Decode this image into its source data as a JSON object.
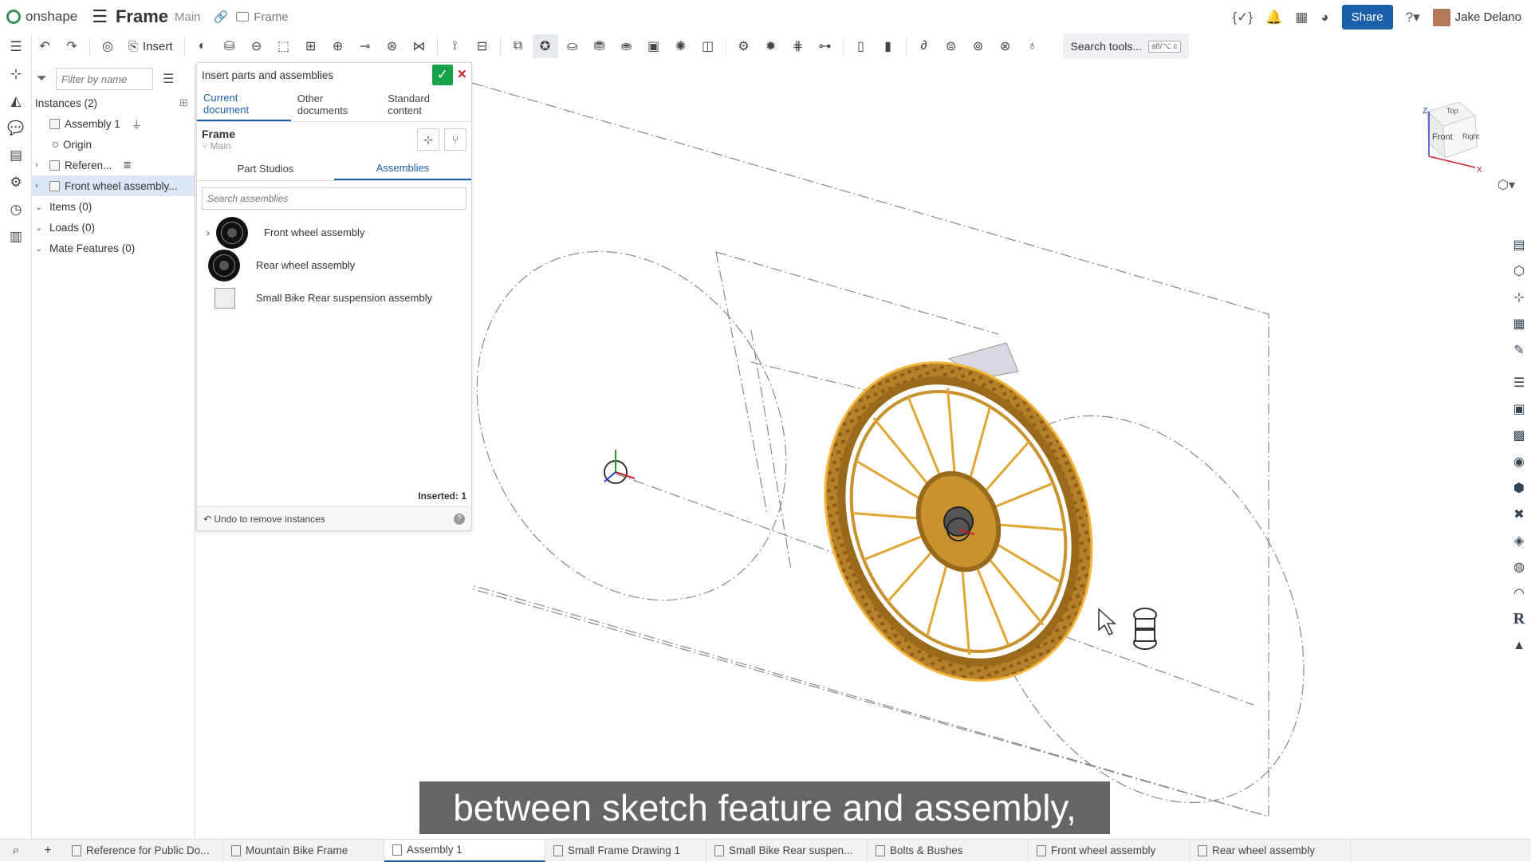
{
  "app": {
    "logo_text": "onshape",
    "doc_title": "Frame",
    "branch": "Main",
    "folder": "Frame"
  },
  "topbar": {
    "share_label": "Share",
    "user_name": "Jake Delano"
  },
  "toolbar": {
    "insert_label": "Insert",
    "search_label": "Search tools...",
    "search_shortcut": "alt/⌥ c"
  },
  "tree": {
    "filter_placeholder": "Filter by name",
    "instances_label": "Instances (2)",
    "items": [
      {
        "label": "Assembly 1"
      },
      {
        "label": "Origin"
      },
      {
        "label": "Referen..."
      },
      {
        "label": "Front wheel assembly..."
      }
    ],
    "items_group": "Items (0)",
    "loads_group": "Loads (0)",
    "mate_group": "Mate Features (0)"
  },
  "dialog": {
    "title": "Insert parts and assemblies",
    "tabs": [
      "Current document",
      "Other documents",
      "Standard content"
    ],
    "doc_name": "Frame",
    "doc_branch": "Main",
    "sub_tabs": [
      "Part Studios",
      "Assemblies"
    ],
    "search_placeholder": "Search assemblies",
    "assemblies": [
      {
        "label": "Front wheel assembly"
      },
      {
        "label": "Rear wheel assembly"
      },
      {
        "label": "Small Bike Rear suspension assembly"
      }
    ],
    "inserted_label": "Inserted: 1",
    "undo_label": "Undo to remove instances"
  },
  "viewcube": {
    "front": "Front",
    "top": "Top",
    "right": "Right",
    "axis_x": "X",
    "axis_z": "Z"
  },
  "caption": "between sketch feature and assembly,",
  "bottom_tabs": [
    {
      "label": "Reference for Public Do..."
    },
    {
      "label": "Mountain Bike Frame"
    },
    {
      "label": "Assembly 1"
    },
    {
      "label": "Small Frame Drawing 1"
    },
    {
      "label": "Small Bike Rear suspen..."
    },
    {
      "label": "Bolts & Bushes"
    },
    {
      "label": "Front wheel assembly"
    },
    {
      "label": "Rear wheel assembly"
    }
  ],
  "colors": {
    "accent": "#1a5faa",
    "confirm": "#17a34a",
    "cancel": "#c0262d",
    "wheel": "#c8922e"
  }
}
